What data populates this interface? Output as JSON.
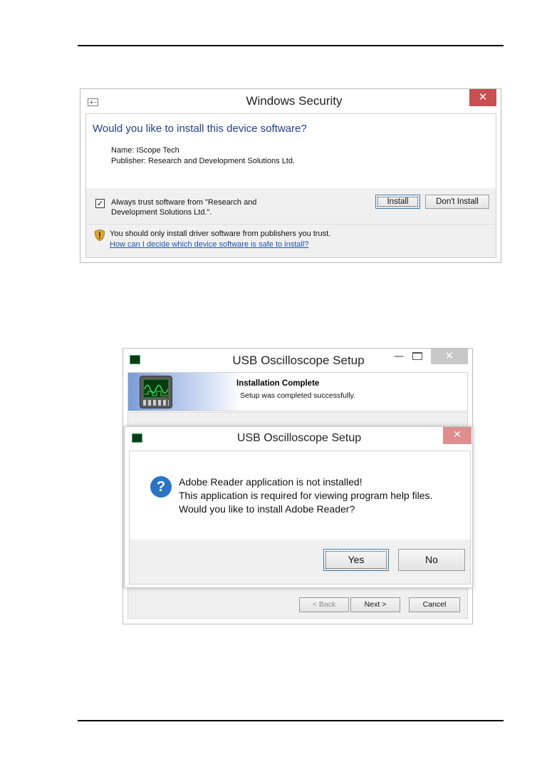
{
  "windows_security": {
    "title": "Windows Security",
    "question": "Would you like to install this device software?",
    "name_line": "Name: IScope Tech",
    "publisher_line": "Publisher: Research and Development Solutions Ltd.",
    "always_trust": "Always trust software from \"Research and Development Solutions Ltd.\".",
    "always_trust_checked": true,
    "install_label": "Install",
    "dont_install_label": "Don't Install",
    "warning": "You should only install driver software from publishers you trust.",
    "help_link": "How can I decide which device software is safe to install?",
    "close_icon": "close-icon",
    "shield_icon": "shield-icon"
  },
  "setup_window": {
    "title": "USB Oscilloscope Setup",
    "heading": "Installation Complete",
    "subheading": "Setup was completed successfully.",
    "back_label": "< Back",
    "next_label": "Next >",
    "cancel_label": "Cancel",
    "app_icon": "oscilloscope-icon"
  },
  "message_box": {
    "title": "USB Oscilloscope Setup",
    "lines": [
      "Adobe Reader application is not installed!",
      "This application is required for viewing program help files.",
      "Would you like to install Adobe Reader?"
    ],
    "yes_label": "Yes",
    "no_label": "No",
    "question_icon": "question-icon"
  },
  "colors": {
    "link": "#1a56b5",
    "question_heading": "#1e3f8f",
    "close_button": "#c75050",
    "question_icon": "#2a74c3"
  }
}
